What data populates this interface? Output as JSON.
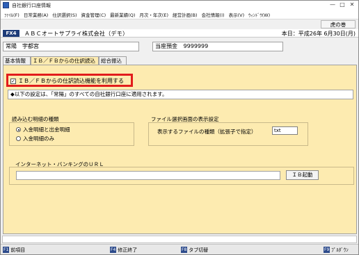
{
  "window": {
    "title": "自社銀行口座情報",
    "controls": [
      "—",
      "□",
      "✕"
    ]
  },
  "menu": [
    "ﾌｧｲﾙ(F)",
    "日常業務(A)",
    "仕訳選択(S)",
    "資金管理(C)",
    "最新業績(Q)",
    "月次・年次(E)",
    "経営計画(B)",
    "会社情報(I)",
    "表示(V)",
    "ｳｨﾝﾄﾞｳ(W)"
  ],
  "top_right_label": "虎の巻",
  "company": {
    "badge": "FX4",
    "name": "ＡＢＣオートサプライ株式会社（デモ）",
    "date": "本日：平成26年 6月30日(月)"
  },
  "account": {
    "name": "常陽　宇都宮",
    "balance_label": "当座預金",
    "balance_value": "9999999"
  },
  "tabs": [
    "基本情報",
    "ＩＢ／ＦＢからの仕訳読込",
    "総合振込"
  ],
  "panel": {
    "checkbox_label": "ＩＢ／ＦＢからの仕訳読込機能を利用する",
    "checkbox_checked": true,
    "notice": "◆以下の設定は、「常陽」のすべての自社銀行口座に適用されます。",
    "detail_section": {
      "title": "読み込む明細の種類",
      "options": [
        "入金明細と出金明細",
        "入金明細のみ"
      ],
      "selected_index": 0
    },
    "file_section": {
      "title": "ファイル選択画面の表示設定",
      "ext_label": "表示するファイルの種類（拡張子で指定）",
      "ext_value": "txt"
    },
    "url_section": {
      "title": "インターネット・バンキングのＵＲＬ",
      "url_value": "",
      "button_label": "ＩＢ起動"
    }
  },
  "function_keys": [
    {
      "key": "F1",
      "label": "前項目"
    },
    {
      "key": "F4",
      "label": "修正終了"
    },
    {
      "key": "F8",
      "label": "タブ切替"
    },
    {
      "key": "F9",
      "label": "ﾌﾟﾙﾀﾞｳﾝ"
    }
  ]
}
